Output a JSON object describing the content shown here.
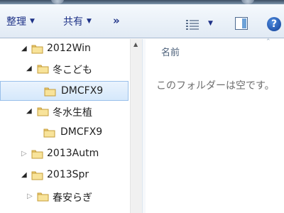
{
  "toolbar": {
    "organize_label": "整理",
    "share_label": "共有",
    "more_label": "»"
  },
  "tree": {
    "items": [
      {
        "label": "2012Win",
        "expanded": true,
        "selected": false
      },
      {
        "label": "冬こども",
        "expanded": true,
        "selected": false
      },
      {
        "label": "DMCFX9",
        "expanded": null,
        "selected": true
      },
      {
        "label": "冬水生植",
        "expanded": true,
        "selected": false
      },
      {
        "label": "DMCFX9",
        "expanded": null,
        "selected": false
      },
      {
        "label": "2013Autm",
        "expanded": false,
        "selected": false
      },
      {
        "label": "2013Spr",
        "expanded": true,
        "selected": false
      },
      {
        "label": "春安らぎ",
        "expanded": false,
        "selected": false
      }
    ]
  },
  "content": {
    "column_name": "名前",
    "empty_message": "このフォルダーは空です。"
  },
  "icons": {
    "organize_caret": "chevron-down-icon",
    "share_caret": "chevron-down-icon",
    "view": "details-view-icon",
    "preview_pane": "preview-pane-icon",
    "help": "help-icon",
    "folder": "folder-icon"
  },
  "colors": {
    "toolbar_text": "#1e3287",
    "selection_bg": "#d5e8fb",
    "selection_border": "#9ac0ea",
    "folder_yellow": "#f3d57a"
  }
}
